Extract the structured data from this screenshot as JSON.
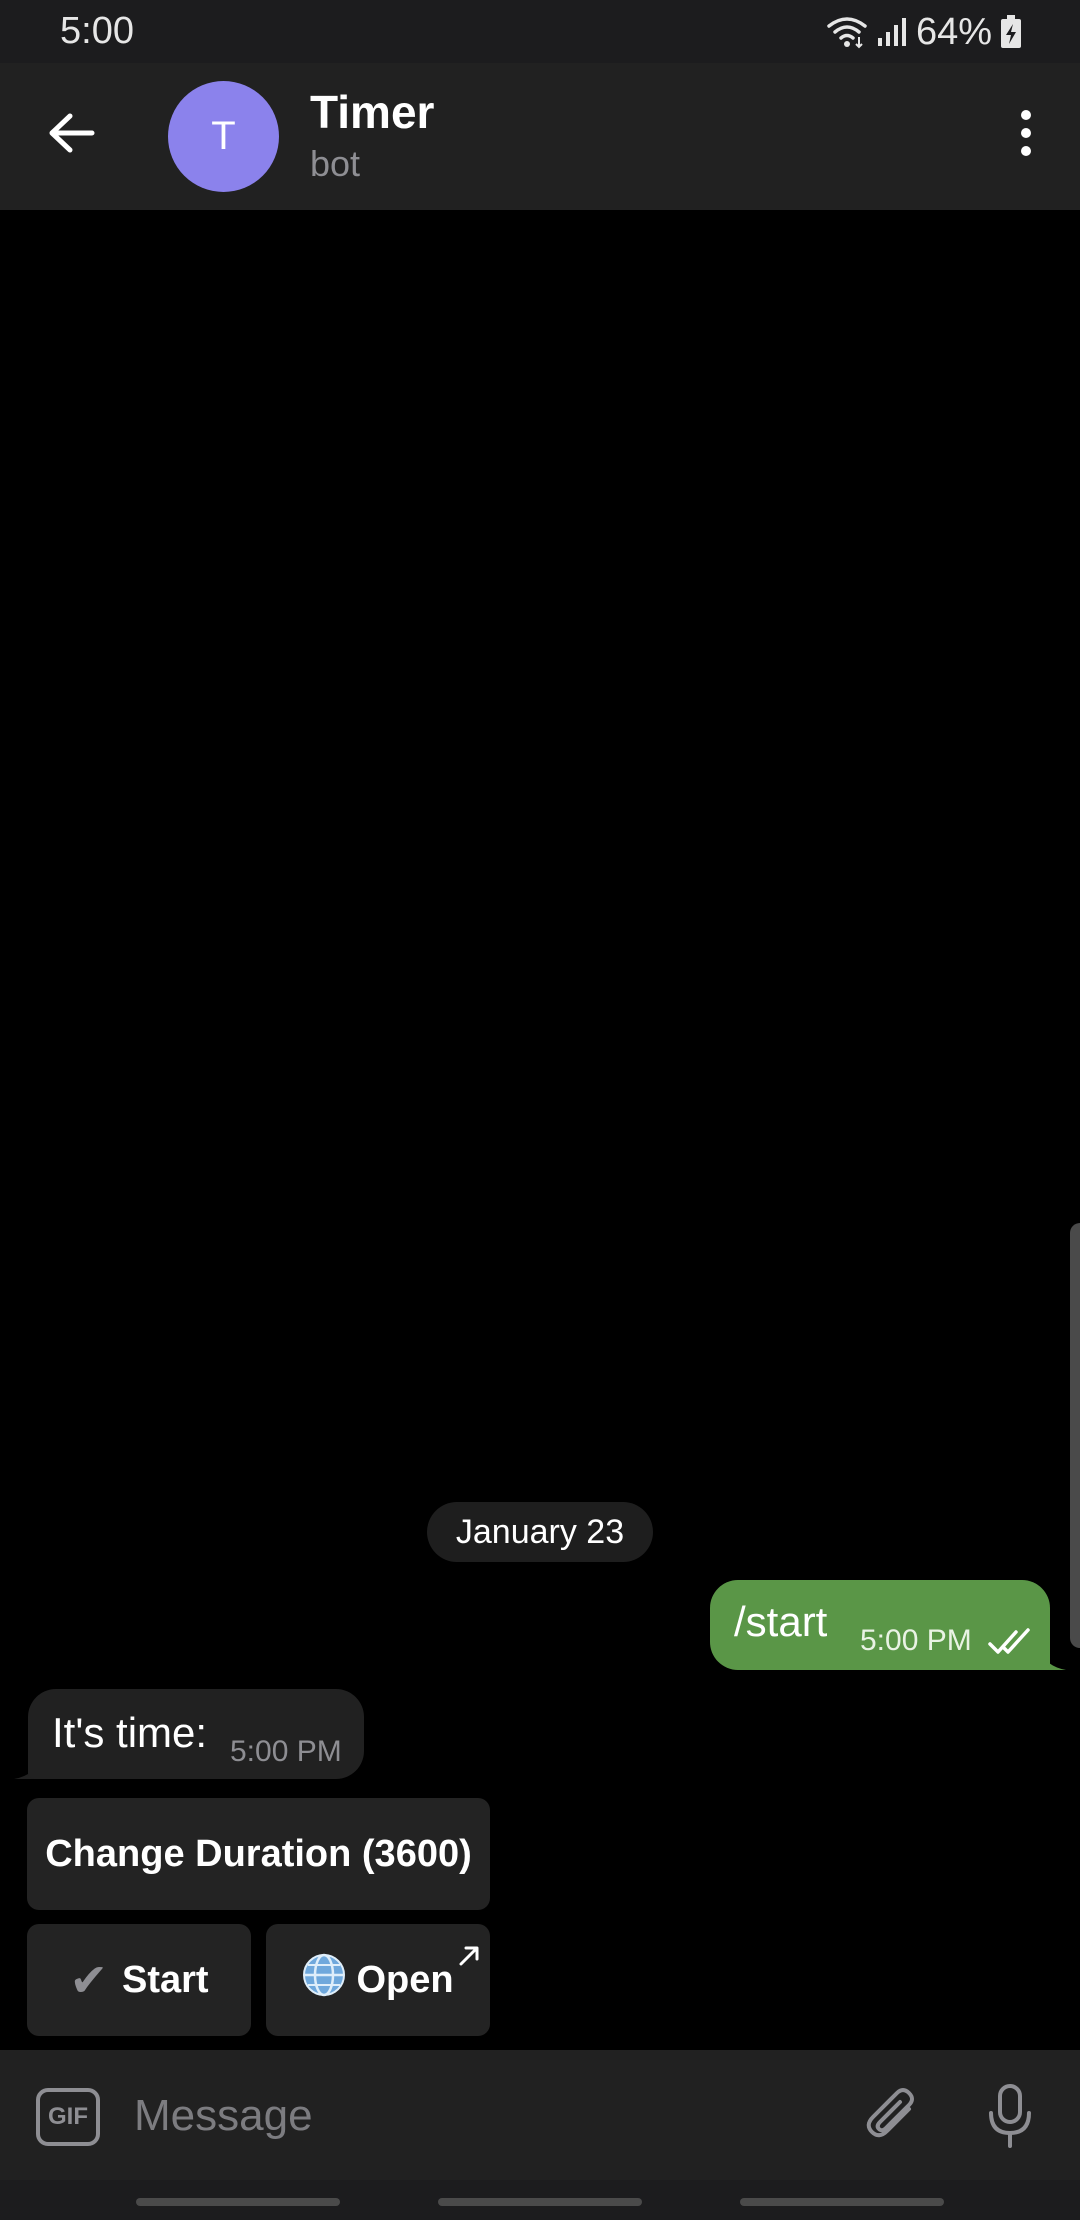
{
  "status_bar": {
    "time": "5:00",
    "battery": "64%",
    "icons": [
      "wifi-icon",
      "signal-icon",
      "battery-charging-icon"
    ]
  },
  "header": {
    "back_icon": "back-arrow-icon",
    "avatar_letter": "T",
    "avatar_color": "#8b82ec",
    "title": "Timer",
    "subtitle": "bot",
    "menu_icon": "more-vertical-icon"
  },
  "chat": {
    "date_separator": "January 23",
    "messages": [
      {
        "direction": "outgoing",
        "text": "/start",
        "time": "5:00 PM",
        "status_icon": "double-check-icon",
        "bubble_color": "#5a9647"
      },
      {
        "direction": "incoming",
        "text": "It's time:",
        "time": "5:00 PM",
        "bubble_color": "#212121"
      }
    ],
    "inline_keyboard": {
      "change_duration": "Change Duration (3600)",
      "start": {
        "check_glyph": "✔",
        "label": "Start"
      },
      "open": {
        "icon": "globe-icon",
        "label": "Open",
        "link_icon": "external-arrow-icon"
      }
    }
  },
  "input_bar": {
    "gif_label": "GIF",
    "placeholder": "Message",
    "attach_icon": "paperclip-icon",
    "mic_icon": "microphone-icon"
  },
  "colors": {
    "background": "#000000",
    "header": "#212121",
    "outgoing_bubble": "#5a9647",
    "incoming_bubble": "#212121",
    "avatar": "#8b82ec"
  }
}
